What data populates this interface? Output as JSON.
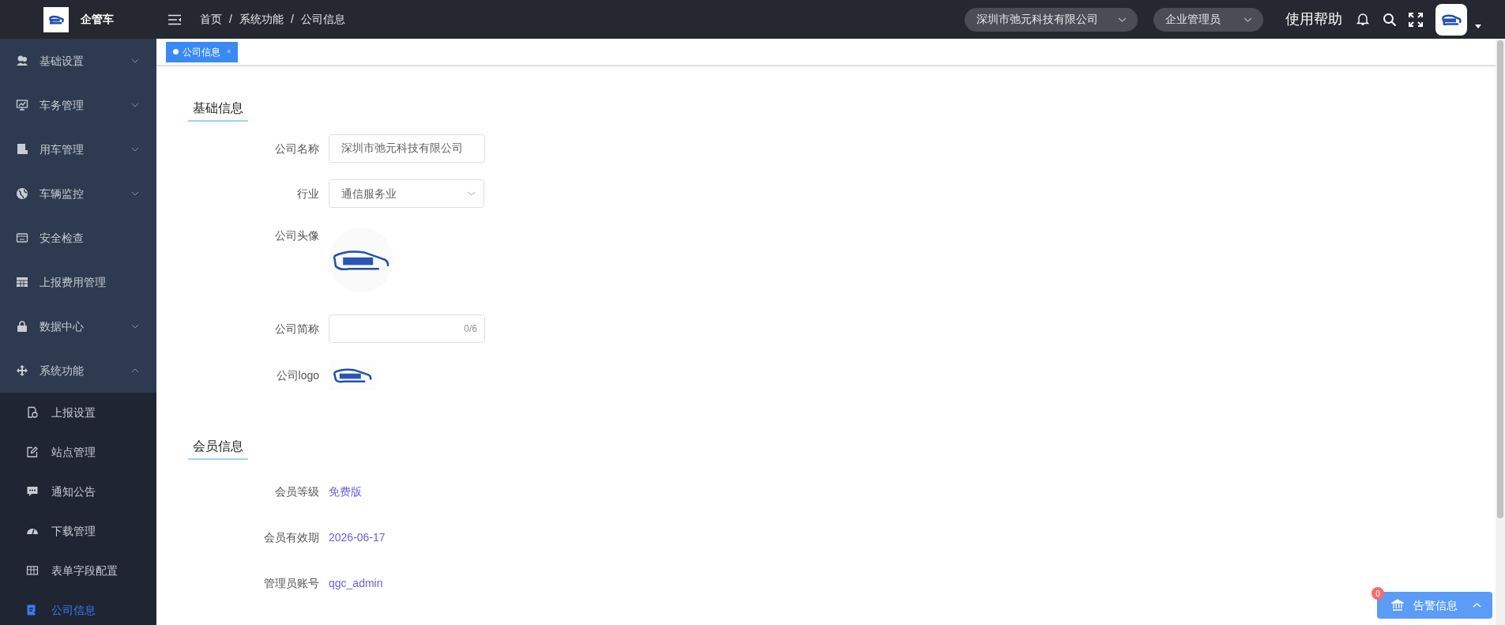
{
  "brand": {
    "title": "企管车"
  },
  "sidebar": {
    "items": [
      {
        "label": "基础设置",
        "expanded": false
      },
      {
        "label": "车务管理",
        "expanded": false
      },
      {
        "label": "用车管理",
        "expanded": false
      },
      {
        "label": "车辆监控",
        "expanded": false
      },
      {
        "label": "安全检查"
      },
      {
        "label": "上报费用管理"
      },
      {
        "label": "数据中心",
        "expanded": false
      },
      {
        "label": "系统功能",
        "expanded": true,
        "children": [
          {
            "label": "上报设置",
            "selected": false
          },
          {
            "label": "站点管理",
            "selected": false
          },
          {
            "label": "通知公告",
            "selected": false
          },
          {
            "label": "下载管理",
            "selected": false
          },
          {
            "label": "表单字段配置",
            "selected": false
          },
          {
            "label": "公司信息",
            "selected": true
          }
        ]
      }
    ]
  },
  "header": {
    "breadcrumb": [
      "首页",
      "系统功能",
      "公司信息"
    ],
    "separator": "/",
    "company_select": "深圳市弛元科技有限公司",
    "role_select": "企业管理员",
    "help": "使用帮助"
  },
  "tabs": [
    {
      "label": "公司信息",
      "close": "×",
      "selected": true
    }
  ],
  "sections": [
    {
      "title": "基础信息",
      "fields": [
        {
          "kind": "input",
          "label": "公司名称",
          "value": "深圳市弛元科技有限公司"
        },
        {
          "kind": "select",
          "label": "行业",
          "value": "通信服务业"
        },
        {
          "kind": "image",
          "label": "公司头像"
        },
        {
          "kind": "counter",
          "label": "公司简称",
          "counter": "0/6"
        },
        {
          "kind": "logo",
          "label": "公司logo"
        }
      ]
    },
    {
      "title": "会员信息",
      "fields": [
        {
          "kind": "text",
          "label": "会员等级",
          "value": "免费版"
        },
        {
          "kind": "text",
          "label": "会员有效期",
          "value": "2026-06-17"
        },
        {
          "kind": "text",
          "label": "管理员账号",
          "value": "qgc_admin"
        }
      ]
    }
  ],
  "alert": {
    "count": "0",
    "label": "告警信息"
  }
}
